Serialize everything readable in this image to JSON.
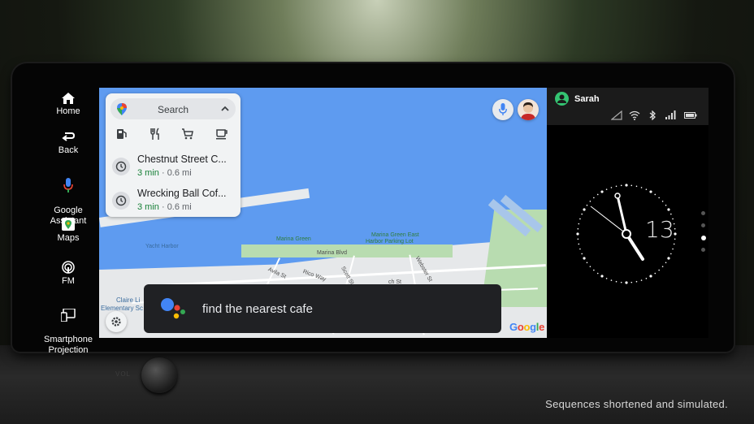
{
  "rail": {
    "items": [
      {
        "label": "Home"
      },
      {
        "label": "Back"
      },
      {
        "label": "Google\nAssistant"
      },
      {
        "label": "Maps"
      },
      {
        "label": "FM"
      },
      {
        "label": "Smartphone\nProjection"
      }
    ]
  },
  "search": {
    "label": "Search",
    "categories": [
      "gas-station",
      "restaurants",
      "shopping",
      "coffee"
    ],
    "recents": [
      {
        "title": "Chestnut Street C...",
        "time": "3 min",
        "distance": "0.6 mi"
      },
      {
        "title": "Wrecking Ball Cof...",
        "time": "3 min",
        "distance": "0.6 mi"
      }
    ]
  },
  "map_labels": {
    "yacht_harbor": "Yacht Harbor",
    "marina_green": "Marina Green",
    "marina_green_east": "Marina Green East",
    "harbor_parking": "Harbor Parking Lot",
    "marina_blvd": "Marina Blvd",
    "avila": "Avila St",
    "rico": "Rico Way",
    "scott": "Scott St",
    "webster": "Webster St",
    "claire_lilienthal": "Claire Li",
    "elementary": "Elementary Sc",
    "beach": "ch St"
  },
  "assistant": {
    "query": "find the nearest cafe"
  },
  "google_logo": "Google",
  "status": {
    "user": "Sarah",
    "clock_hour_display": "13",
    "page_indicator": {
      "total": 4,
      "active": 2
    }
  },
  "caption": "Sequences shortened and simulated.",
  "colors": {
    "water": "#5e9bf0",
    "park": "#b8dcb0",
    "assistant_bg": "#202124",
    "status_bg": "#1b1b1b",
    "user_icon": "#34c472",
    "eta_green": "#188038"
  }
}
